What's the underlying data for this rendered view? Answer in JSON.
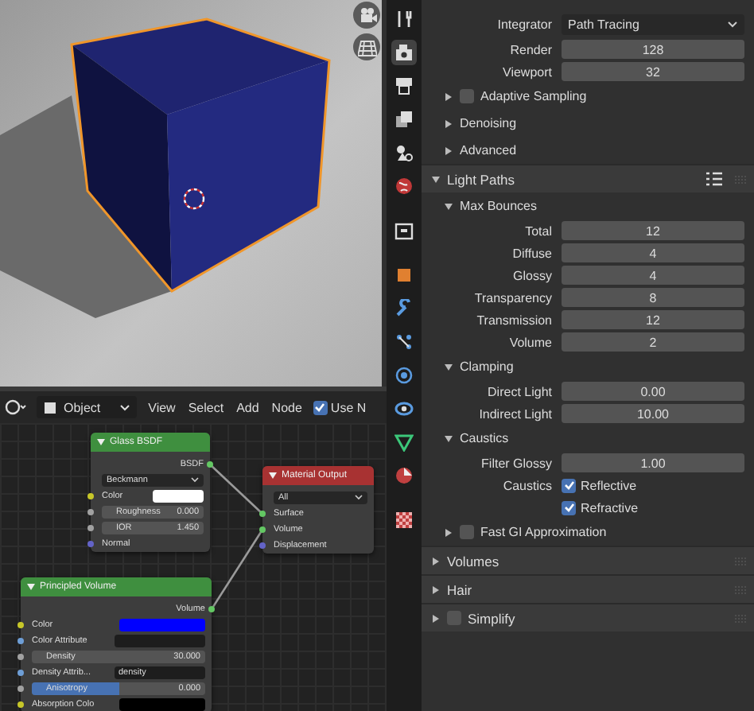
{
  "viewport": {
    "overlay_buttons": [
      {
        "kind": "camera"
      },
      {
        "kind": "grid"
      }
    ]
  },
  "property_tabs": [
    {
      "kind": "tools",
      "selected": false
    },
    {
      "kind": "render",
      "selected": true
    },
    {
      "kind": "output",
      "selected": false
    },
    {
      "kind": "view_layer",
      "selected": false
    },
    {
      "kind": "scene",
      "selected": false
    },
    {
      "kind": "world",
      "selected": false
    },
    {
      "kind": "collection",
      "selected": false
    },
    {
      "kind": "object",
      "selected": false
    },
    {
      "kind": "modifier",
      "selected": false
    },
    {
      "kind": "particles",
      "selected": false
    },
    {
      "kind": "physics",
      "selected": false
    },
    {
      "kind": "constraints",
      "selected": false
    },
    {
      "kind": "data",
      "selected": false
    },
    {
      "kind": "material",
      "selected": false
    },
    {
      "kind": "texture",
      "selected": false
    }
  ],
  "node_header": {
    "mode": "Object",
    "menus": [
      "View",
      "Select",
      "Add",
      "Node"
    ],
    "use_nodes": {
      "label": "Use N",
      "checked": true
    }
  },
  "nodes": [
    {
      "title": "Glass BSDF",
      "color": "#3f8f3f",
      "rows": [
        {
          "kind": "output",
          "label": "BSDF",
          "color": "#63c763"
        },
        {
          "kind": "dropdown",
          "value": "Beckmann"
        },
        {
          "kind": "color",
          "label": "Color",
          "color": "#c7c729",
          "swatch": {
            "color": "#ffffff"
          }
        },
        {
          "kind": "number",
          "label": "Roughness",
          "value": "0.000",
          "color": "#a1a1a1"
        },
        {
          "kind": "number",
          "label": "IOR",
          "value": "1.450",
          "color": "#a1a1a1"
        },
        {
          "kind": "input",
          "label": "Normal",
          "color": "#6363c7"
        }
      ]
    },
    {
      "title": "Material Output",
      "color": "#a83232",
      "rows": [
        {
          "kind": "dropdown",
          "value": "All"
        },
        {
          "kind": "input",
          "label": "Surface",
          "color": "#63c763"
        },
        {
          "kind": "input",
          "label": "Volume",
          "color": "#63c763"
        },
        {
          "kind": "input",
          "label": "Displacement",
          "color": "#6363c7"
        }
      ]
    },
    {
      "title": "Principled Volume",
      "color": "#3f8f3f",
      "rows": [
        {
          "kind": "output",
          "label": "Volume",
          "color": "#63c763"
        },
        {
          "kind": "color",
          "label": "Color",
          "color": "#c7c729",
          "swatch": {
            "color": "#0000ff"
          }
        },
        {
          "kind": "field",
          "label": "Color Attribute",
          "color": "#6e9ed6"
        },
        {
          "kind": "number",
          "label": "Density",
          "value": "30.000",
          "color": "#a1a1a1"
        },
        {
          "kind": "field",
          "label": "Density Attrib...",
          "value": "density",
          "color": "#6e9ed6"
        },
        {
          "kind": "slider",
          "label": "Anisotropy",
          "value": "0.000",
          "color": "#a1a1a1",
          "level": 0.5
        },
        {
          "kind": "color",
          "label": "Absorption Colo",
          "color": "#c7c729",
          "swatch": {
            "color": "#000000"
          }
        }
      ]
    }
  ],
  "properties": {
    "rows": [
      {
        "kind": "dropdown",
        "label": "Integrator",
        "value": "Path Tracing"
      },
      {
        "kind": "number",
        "label": "Render",
        "value": "128"
      },
      {
        "kind": "number",
        "label": "Viewport",
        "value": "32"
      },
      {
        "kind": "subpanel",
        "label": "Adaptive Sampling",
        "expanded": false,
        "checked": false
      },
      {
        "kind": "subpanel",
        "label": "Denoising",
        "expanded": false
      },
      {
        "kind": "subpanel",
        "label": "Advanced",
        "expanded": false
      },
      {
        "kind": "panel",
        "label": "Light Paths",
        "expanded": true
      },
      {
        "kind": "subpanel",
        "label": "Max Bounces",
        "expanded": true
      },
      {
        "kind": "number",
        "label": "Total",
        "value": "12"
      },
      {
        "kind": "number",
        "label": "Diffuse",
        "value": "4"
      },
      {
        "kind": "number",
        "label": "Glossy",
        "value": "4"
      },
      {
        "kind": "number",
        "label": "Transparency",
        "value": "8"
      },
      {
        "kind": "number",
        "label": "Transmission",
        "value": "12"
      },
      {
        "kind": "number",
        "label": "Volume",
        "value": "2"
      },
      {
        "kind": "subpanel",
        "label": "Clamping",
        "expanded": true
      },
      {
        "kind": "number",
        "label": "Direct Light",
        "value": "0.00"
      },
      {
        "kind": "number",
        "label": "Indirect Light",
        "value": "10.00"
      },
      {
        "kind": "subpanel",
        "label": "Caustics",
        "expanded": true
      },
      {
        "kind": "number",
        "label": "Filter Glossy",
        "value": "1.00"
      },
      {
        "kind": "check",
        "label": "Caustics",
        "text": "Reflective",
        "checked": true
      },
      {
        "kind": "check",
        "text": "Refractive",
        "checked": true
      },
      {
        "kind": "subpanel",
        "label": "Fast GI Approximation",
        "expanded": false,
        "checked": false
      },
      {
        "kind": "panel",
        "label": "Volumes",
        "expanded": false
      },
      {
        "kind": "panel",
        "label": "Hair",
        "expanded": false
      },
      {
        "kind": "panel",
        "label": "Simplify",
        "expanded": false,
        "checked": false
      }
    ]
  }
}
